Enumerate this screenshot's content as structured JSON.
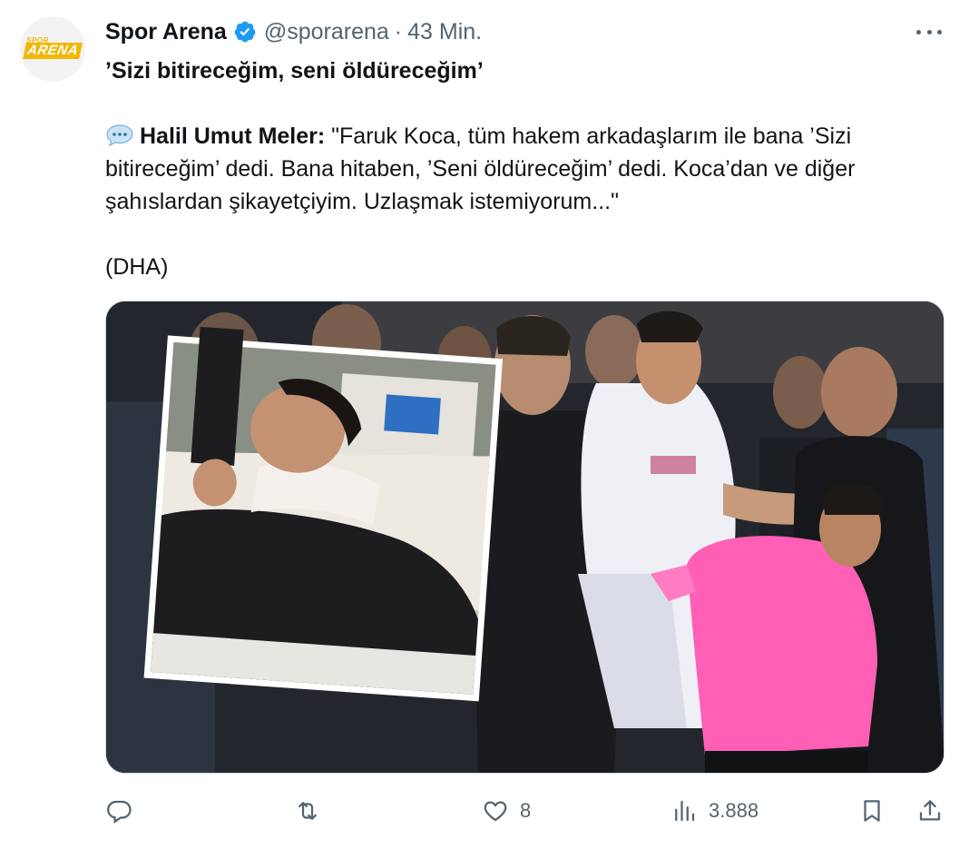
{
  "author": {
    "display_name": "Spor Arena",
    "handle": "@sporarena",
    "separator": "·",
    "time": "43 Min.",
    "avatar_logo_small": "SPOR",
    "avatar_logo_big": "ARENA",
    "verified_icon": "verified-badge-icon",
    "verified_color": "#1d9bf0",
    "brand_color": "#f2b705"
  },
  "tweet": {
    "headline": "’Sizi bitireceğim, seni öldüreceğim’",
    "speech_icon": "speech-balloon-icon",
    "speaker": "Halil Umut Meler:",
    "quote": " \"Faruk Koca, tüm hakem arkadaşlarım ile bana ’Sizi bitireceğim’ dedi. Bana hitaben, ’Seni öldüreceğim’ dedi. Koca’dan ve diğer şahıslardan şikayetçiyim. Uzlaşmak istemiyorum...\"",
    "source": "(DHA)"
  },
  "actions": {
    "reply": {
      "icon": "reply-icon",
      "count": ""
    },
    "retweet": {
      "icon": "retweet-icon",
      "count": ""
    },
    "like": {
      "icon": "heart-icon",
      "count": "8"
    },
    "views": {
      "icon": "views-bar-chart-icon",
      "count": "3.888"
    },
    "bookmark": {
      "icon": "bookmark-icon"
    },
    "share": {
      "icon": "share-icon"
    }
  },
  "colors": {
    "text": "#0f1419",
    "secondary": "#536471",
    "border": "#cfd9de",
    "referee_shirt": "#ff5fb4"
  }
}
